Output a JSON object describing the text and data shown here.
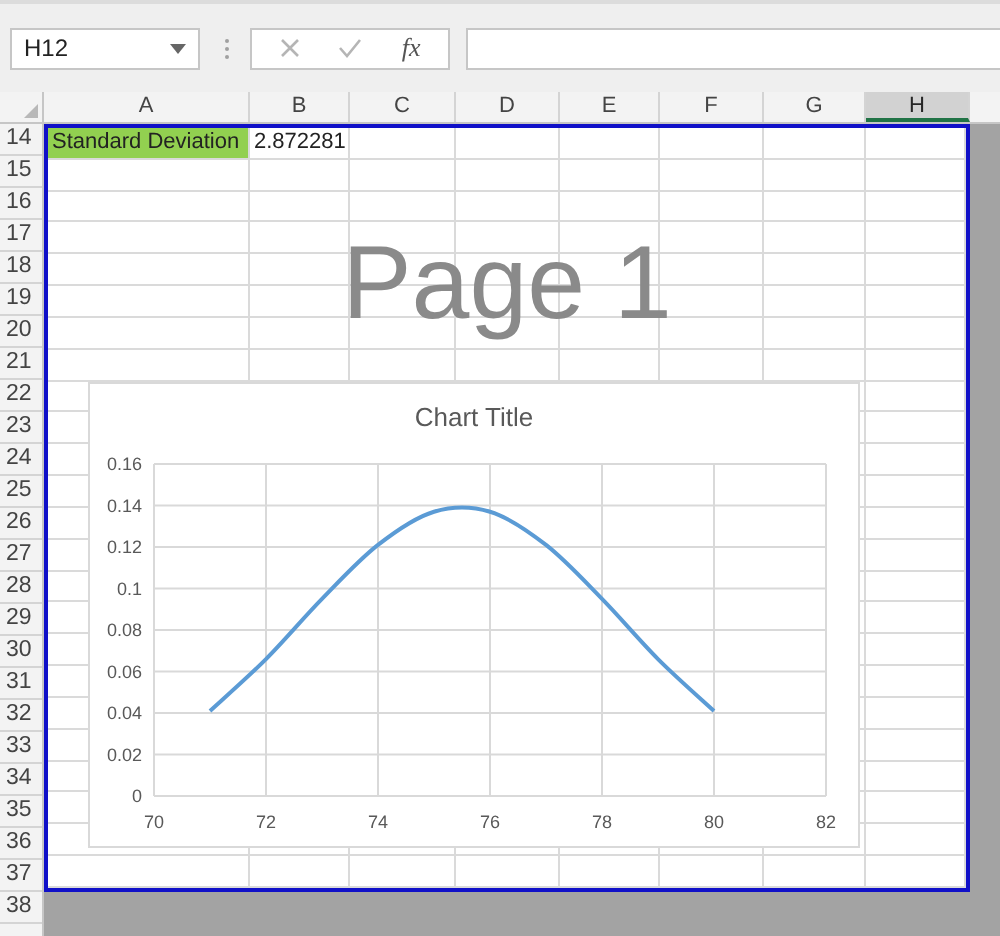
{
  "formula_bar": {
    "name_box": "H12",
    "function_label": "fx"
  },
  "columns": [
    {
      "label": "A",
      "selected": false
    },
    {
      "label": "B",
      "selected": false
    },
    {
      "label": "C",
      "selected": false
    },
    {
      "label": "D",
      "selected": false
    },
    {
      "label": "E",
      "selected": false
    },
    {
      "label": "F",
      "selected": false
    },
    {
      "label": "G",
      "selected": false
    },
    {
      "label": "H",
      "selected": true
    }
  ],
  "rows": [
    {
      "number": "14",
      "in_page": true,
      "cells": [
        {
          "text": "Standard Deviation",
          "highlighted": true
        },
        {
          "text": "2.872281",
          "highlighted": false
        }
      ]
    },
    {
      "number": "15",
      "in_page": true
    },
    {
      "number": "16",
      "in_page": true
    },
    {
      "number": "17",
      "in_page": true
    },
    {
      "number": "18",
      "in_page": true
    },
    {
      "number": "19",
      "in_page": true
    },
    {
      "number": "20",
      "in_page": true
    },
    {
      "number": "21",
      "in_page": true
    },
    {
      "number": "22",
      "in_page": true
    },
    {
      "number": "23",
      "in_page": true
    },
    {
      "number": "24",
      "in_page": true
    },
    {
      "number": "25",
      "in_page": true
    },
    {
      "number": "26",
      "in_page": true
    },
    {
      "number": "27",
      "in_page": true
    },
    {
      "number": "28",
      "in_page": true
    },
    {
      "number": "29",
      "in_page": true
    },
    {
      "number": "30",
      "in_page": true
    },
    {
      "number": "31",
      "in_page": true
    },
    {
      "number": "32",
      "in_page": true
    },
    {
      "number": "33",
      "in_page": true
    },
    {
      "number": "34",
      "in_page": true
    },
    {
      "number": "35",
      "in_page": true
    },
    {
      "number": "36",
      "in_page": true
    },
    {
      "number": "37",
      "in_page": true
    }
  ],
  "rows_outside_page": [
    "38"
  ],
  "page_label": "Page 1",
  "chart": {
    "chart_data": {
      "type": "line",
      "title": "Chart Title",
      "x": [
        71,
        72,
        73,
        74,
        75,
        76,
        77,
        78,
        79,
        80
      ],
      "series": [
        {
          "color": "#5b9bd5",
          "values": [
            0.041,
            0.066,
            0.095,
            0.121,
            0.137,
            0.137,
            0.121,
            0.095,
            0.066,
            0.041
          ]
        }
      ],
      "grid": true,
      "xlim": [
        70,
        82
      ],
      "ylim": [
        0,
        0.16
      ],
      "xticks": [
        70,
        72,
        74,
        76,
        78,
        80,
        82
      ],
      "yticks": [
        0,
        0.02,
        0.04,
        0.06,
        0.08,
        0.1,
        0.12,
        0.14,
        0.16
      ]
    }
  }
}
